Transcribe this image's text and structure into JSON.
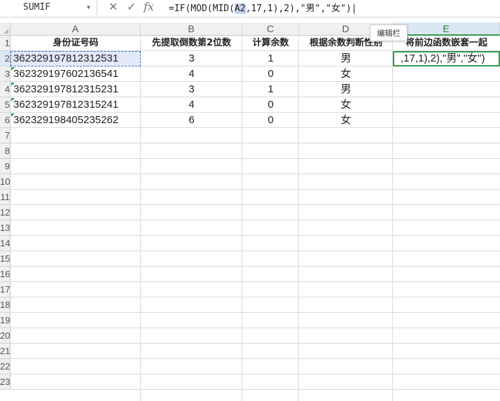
{
  "formula_bar": {
    "name_box": "SUMIF",
    "icons": [
      "close-icon",
      "check-icon",
      "fx-icon"
    ],
    "formula_prefix": "=IF(MOD(MID(",
    "formula_ref": "A2",
    "formula_suffix": ",17,1),2),\"男\",\"女\")|"
  },
  "tooltip": "编辑栏",
  "columns": [
    "A",
    "B",
    "C",
    "D",
    "E"
  ],
  "row_numbers": [
    "1",
    "2",
    "3",
    "4",
    "5",
    "6",
    "7",
    "8",
    "9",
    "10",
    "11",
    "12",
    "13",
    "14",
    "15",
    "16",
    "17",
    "18",
    "19",
    "20",
    "21",
    "22",
    "23"
  ],
  "headers": {
    "a": "身份证号码",
    "b": "先提取倒数第2位数",
    "c": "计算余数",
    "d": "根据余数判断性别",
    "e": "将前边函数嵌套一起"
  },
  "rows": [
    {
      "id": "362329197812312531",
      "digit": "3",
      "rem": "1",
      "gender": "男"
    },
    {
      "id": "362329197602136541",
      "digit": "4",
      "rem": "0",
      "gender": "女"
    },
    {
      "id": "362329197812315231",
      "digit": "3",
      "rem": "1",
      "gender": "男"
    },
    {
      "id": "362329197812315241",
      "digit": "4",
      "rem": "0",
      "gender": "女"
    },
    {
      "id": "362329198405235262",
      "digit": "6",
      "rem": "0",
      "gender": "女"
    }
  ],
  "active_cell_text": ",17,1),2),\"男\",\"女\")",
  "colors": {
    "accent_green": "#2e9a4f",
    "ref_blue": "#3f6ed8"
  }
}
